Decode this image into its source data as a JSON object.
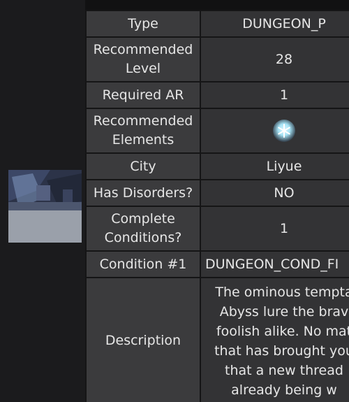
{
  "dungeon_info": {
    "rows": {
      "type": {
        "key": "Type",
        "value": "DUNGEON_P"
      },
      "recommended_level": {
        "key_line1": "Recommended",
        "key_line2": "Level",
        "value": "28"
      },
      "required_ar": {
        "key": "Required AR",
        "value": "1"
      },
      "recommended_elements": {
        "key_line1": "Recommended",
        "key_line2": "Elements",
        "element_icon": "cryo-element-icon"
      },
      "city": {
        "key": "City",
        "value": "Liyue"
      },
      "has_disorders": {
        "key": "Has Disorders?",
        "value": "NO"
      },
      "complete_conditions": {
        "key_line1": "Complete",
        "key_line2": "Conditions?",
        "value": "1"
      },
      "condition_1": {
        "key": "Condition #1",
        "value": "DUNGEON_COND_FI"
      },
      "description": {
        "key": "Description",
        "lines": [
          "The ominous tempta",
          "Abyss lure the brav",
          "foolish alike. No mat",
          "that has brought you",
          "that a new thread",
          "already being w"
        ]
      }
    }
  },
  "colors": {
    "background": "#111112",
    "sidebar": "#1b1b1d",
    "key_cell": "#3b3b3d",
    "value_cell": "#333335",
    "text": "#e6e6e6"
  }
}
